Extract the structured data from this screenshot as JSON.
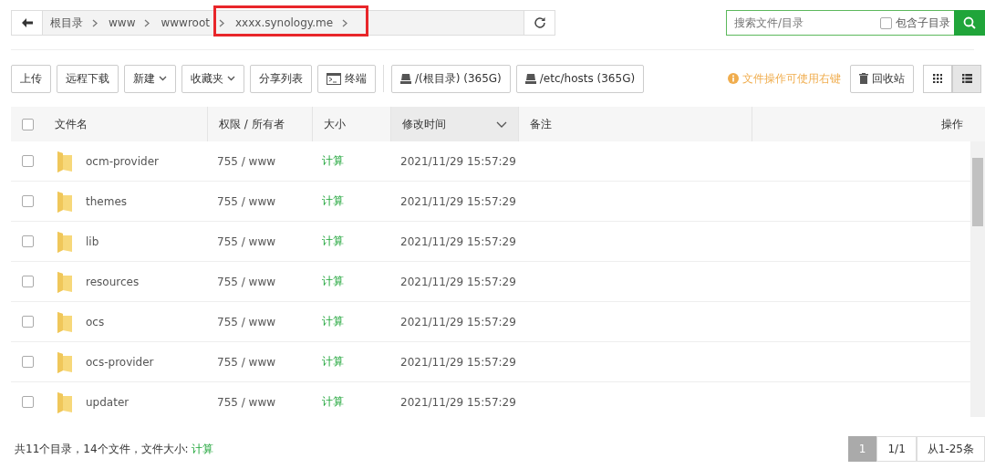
{
  "breadcrumb": {
    "items": [
      "根目录",
      "www",
      "wwwroot",
      "xxxx.synology.me"
    ],
    "highlighted": true
  },
  "search": {
    "placeholder": "搜索文件/目录",
    "include_subdirs": {
      "label": "包含子目录",
      "checked": false
    }
  },
  "toolbar": {
    "buttons": [
      {
        "label": "上传",
        "kind": "plain"
      },
      {
        "label": "远程下载",
        "kind": "plain"
      },
      {
        "label": "新建",
        "kind": "dropdown"
      },
      {
        "label": "收藏夹",
        "kind": "dropdown"
      },
      {
        "label": "分享列表",
        "kind": "plain"
      },
      {
        "label": "终端",
        "kind": "terminal"
      }
    ],
    "disks": [
      "/(根目录) (365G)",
      "/etc/hosts (365G)"
    ],
    "hint": "文件操作可使用右键",
    "recycle": "回收站",
    "views": [
      {
        "kind": "grid",
        "selected": false
      },
      {
        "kind": "list",
        "selected": true
      }
    ]
  },
  "table": {
    "select_all": false,
    "columns": [
      {
        "label": "文件名",
        "sorted": false
      },
      {
        "label": "权限 / 所有者",
        "sorted": false
      },
      {
        "label": "大小",
        "sorted": false
      },
      {
        "label": "修改时间",
        "sorted": true
      },
      {
        "label": "备注",
        "sorted": false
      },
      {
        "label": "操作",
        "sorted": false
      }
    ],
    "rows": [
      {
        "name": "ocm-provider",
        "perm": "755 / www",
        "size": "计算",
        "modified": "2021/11/29 15:57:29",
        "checked": false
      },
      {
        "name": "themes",
        "perm": "755 / www",
        "size": "计算",
        "modified": "2021/11/29 15:57:29",
        "checked": false
      },
      {
        "name": "lib",
        "perm": "755 / www",
        "size": "计算",
        "modified": "2021/11/29 15:57:29",
        "checked": false
      },
      {
        "name": "resources",
        "perm": "755 / www",
        "size": "计算",
        "modified": "2021/11/29 15:57:29",
        "checked": false
      },
      {
        "name": "ocs",
        "perm": "755 / www",
        "size": "计算",
        "modified": "2021/11/29 15:57:29",
        "checked": false
      },
      {
        "name": "ocs-provider",
        "perm": "755 / www",
        "size": "计算",
        "modified": "2021/11/29 15:57:29",
        "checked": false
      },
      {
        "name": "updater",
        "perm": "755 / www",
        "size": "计算",
        "modified": "2021/11/29 15:57:29",
        "checked": false
      }
    ]
  },
  "status_bar": {
    "summary": "共11个目录，14个文件，文件大小:",
    "size_link": "计算",
    "pages": [
      {
        "label": "1",
        "selected": true
      },
      {
        "label": "1/1",
        "selected": false
      },
      {
        "label": "从1-25条",
        "selected": false
      }
    ]
  }
}
